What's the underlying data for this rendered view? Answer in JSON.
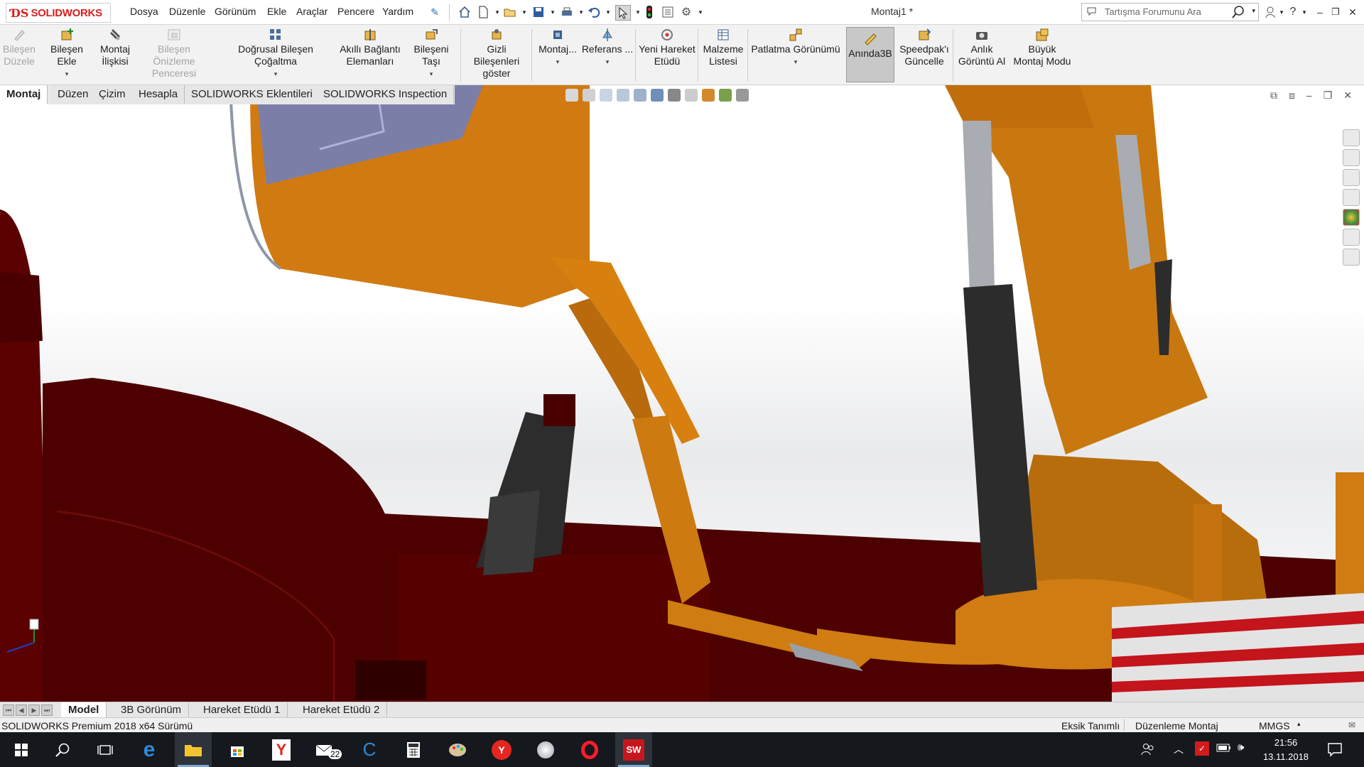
{
  "app": {
    "logo_text": "SOLIDWORKS",
    "document_title": "Montaj1 *"
  },
  "menu": {
    "items": [
      "Dosya",
      "Düzenle",
      "Görünüm",
      "Ekle",
      "Araçlar",
      "Pencere",
      "Yardım"
    ]
  },
  "search": {
    "placeholder": "Tartışma Forumunu Ara"
  },
  "command_manager": {
    "buttons": [
      {
        "label1": "Bileşen",
        "label2": "Düzele",
        "disabled": true,
        "icon": "edit-component-icon"
      },
      {
        "label1": "Bileşen Ekle",
        "label2": "",
        "disabled": false,
        "icon": "insert-component-icon"
      },
      {
        "label1": "Montaj",
        "label2": "İlişkisi",
        "disabled": false,
        "icon": "mate-icon"
      },
      {
        "label1": "Bileşen Önizleme",
        "label2": "Penceresi",
        "disabled": true,
        "icon": "component-preview-icon"
      },
      {
        "label1": "Doğrusal Bileşen Çoğaltma",
        "label2": "",
        "disabled": false,
        "icon": "linear-pattern-icon"
      },
      {
        "label1": "Akıllı Bağlantı",
        "label2": "Elemanları",
        "disabled": false,
        "icon": "smart-fasteners-icon"
      },
      {
        "label1": "Bileşeni Taşı",
        "label2": "",
        "disabled": false,
        "icon": "move-component-icon"
      },
      {
        "label1": "Gizli Bileşenleri",
        "label2": "göster",
        "disabled": false,
        "icon": "show-hidden-icon"
      },
      {
        "label1": "Montaj...",
        "label2": "",
        "disabled": false,
        "icon": "assembly-features-icon"
      },
      {
        "label1": "Referans ...",
        "label2": "",
        "disabled": false,
        "icon": "reference-geometry-icon"
      },
      {
        "label1": "Yeni Hareket",
        "label2": "Etüdü",
        "disabled": false,
        "icon": "new-motion-study-icon"
      },
      {
        "label1": "Malzeme",
        "label2": "Listesi",
        "disabled": false,
        "icon": "bill-of-materials-icon"
      },
      {
        "label1": "Patlatma Görünümü",
        "label2": "",
        "disabled": false,
        "icon": "exploded-view-icon"
      },
      {
        "label1": "Anında3B",
        "label2": "",
        "disabled": false,
        "icon": "instant3d-icon"
      },
      {
        "label1": "Speedpak'ı",
        "label2": "Güncelle",
        "disabled": false,
        "icon": "speedpak-icon"
      },
      {
        "label1": "Anlık",
        "label2": "Görüntü Al",
        "disabled": false,
        "icon": "snapshot-icon"
      },
      {
        "label1": "Büyük",
        "label2": "Montaj Modu",
        "disabled": false,
        "icon": "large-assembly-icon"
      }
    ]
  },
  "tabs": [
    "Montaj",
    "Düzen",
    "Çizim",
    "Hesapla",
    "SOLIDWORKS Eklentileri",
    "SOLIDWORKS Inspection"
  ],
  "model_tabs": [
    "Model",
    "3B Görünüm",
    "Hareket Etüdü 1",
    "Hareket Etüdü 2"
  ],
  "status": {
    "version": "SOLIDWORKS Premium 2018 x64 Sürümü",
    "definition": "Eksik Tanımlı",
    "mode": "Düzenleme Montaj",
    "units": "MMGS"
  },
  "taskbar": {
    "mail_badge": "22",
    "time": "21:56",
    "date": "13.11.2018",
    "sw_label": "SW"
  },
  "colors": {
    "orange": "#d9780f",
    "dark_red": "#4c0000",
    "ds_red": "#d6201d"
  }
}
